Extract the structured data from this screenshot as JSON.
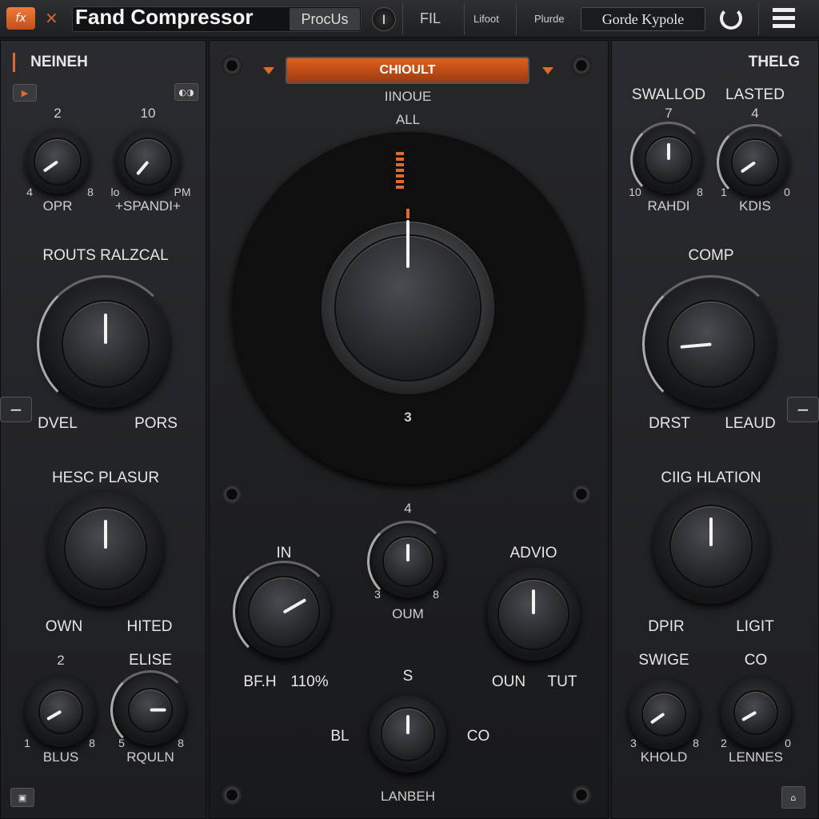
{
  "topbar": {
    "logo": "fx",
    "close": "×",
    "title": "Fand Compressor",
    "mode_button": "ProcUs",
    "bypass": "I",
    "tab1": "FIL",
    "tab2": "Lifoot",
    "tab3": "Plurde",
    "preset": "Gorde Kypole"
  },
  "colors": {
    "accent": "#e06a2e",
    "panel": "#2a2b2e",
    "text": "#e6e6e6"
  },
  "left": {
    "title": "NEINEH",
    "play_icon": "play-icon",
    "link_label": "◐◑",
    "bottom_button": "▣"
  },
  "right": {
    "title": "THELG",
    "bottom_button": "⌂"
  },
  "center": {
    "mode": "CHIOULT",
    "label1": "IINOUE",
    "label2": "ALL",
    "dial_value": "3"
  },
  "knobs": {
    "k1": {
      "top": "2",
      "min": "4",
      "max": "8",
      "label": "OPR",
      "angle": -125
    },
    "k2": {
      "top": "10",
      "min": "lo",
      "max": "PM",
      "label": "+SPANDI+",
      "angle": -140
    },
    "k3": {
      "top": "ROUTS RALZCAL",
      "min": "DVEL",
      "max": "PORS",
      "angle": 0
    },
    "k4": {
      "top": "HESC PLASUR",
      "min": "OWN",
      "max": "HITED",
      "angle": 0
    },
    "k5": {
      "top": "2",
      "min": "1",
      "max": "8",
      "label": "BLUS",
      "angle": -120
    },
    "k6": {
      "top": "ELISE",
      "min": "5",
      "max": "8",
      "label": "RQULN",
      "angle": 90
    },
    "k7": {
      "head": "SWALLOD",
      "top": "7",
      "min": "10",
      "max": "8",
      "label": "RAHDI",
      "angle": 0
    },
    "k8": {
      "head": "LASTED",
      "top": "4",
      "min": "1",
      "max": "0",
      "label": "KDIS",
      "angle": -125
    },
    "k9": {
      "top": "COMP",
      "min": "DRST",
      "max": "LEAUD",
      "angle": -95
    },
    "k10": {
      "top": "CIIG HLATION",
      "min": "DPIR",
      "max": "LIGIT",
      "angle": 0
    },
    "k11": {
      "top": "SWIGE",
      "min": "3",
      "max": "8",
      "label": "KHOLD",
      "angle": -125
    },
    "k12": {
      "top": "CO",
      "min": "2",
      "max": "0",
      "label": "LENNES",
      "angle": -120
    },
    "kin": {
      "top": "IN",
      "min": "BF.H",
      "max": "110%",
      "angle": 60
    },
    "koum": {
      "top": "4",
      "min": "3",
      "max": "8",
      "label": "OUM",
      "angle": 0
    },
    "kadv": {
      "top": "ADVIO",
      "min": "OUN",
      "max": "TUT",
      "angle": 0
    },
    "kbot": {
      "top": "S",
      "min": "BL",
      "max": "CO",
      "label": "LANBEH",
      "angle": 0
    },
    "main": {
      "angle": 0
    }
  }
}
